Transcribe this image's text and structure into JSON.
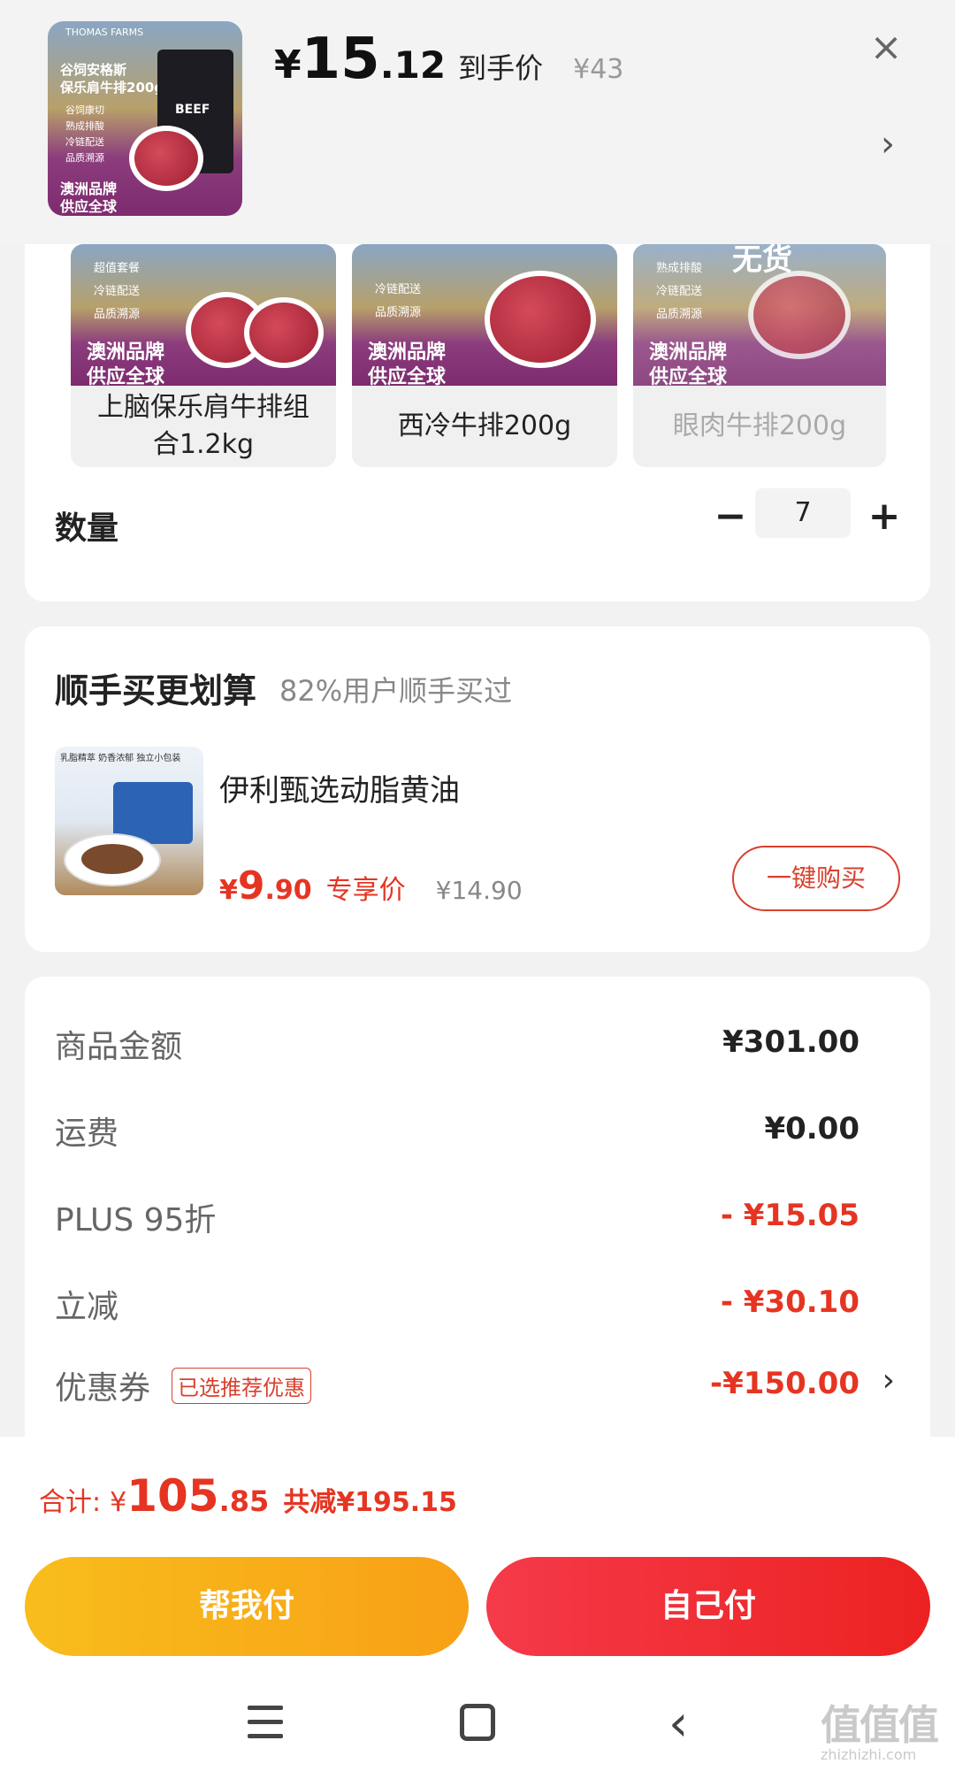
{
  "header": {
    "currency": "¥",
    "price_int": "15",
    "price_dec": ".12",
    "price_tag": "到手价",
    "original_price": "¥43",
    "close_label": "×",
    "arrow": "›",
    "thumb": {
      "brand": "THOMAS FARMS",
      "title_line1": "谷饲安格斯",
      "title_line2": "保乐肩牛排200g",
      "tags": [
        "谷饲康切",
        "熟成排酸",
        "冷链配送",
        "品质溯源"
      ],
      "slogan_line1": "澳洲品牌",
      "slogan_line2": "供应全球",
      "bag_text": "BEEF"
    }
  },
  "specs": {
    "items": [
      {
        "label": "上脑保乐肩牛排组合1.2kg",
        "tags": [
          "超值套餐",
          "冷链配送",
          "品质溯源"
        ],
        "slogan_line1": "澳洲品牌",
        "slogan_line2": "供应全球",
        "disabled": false
      },
      {
        "label": "西冷牛排200g",
        "tags": [
          "冷链配送",
          "品质溯源"
        ],
        "slogan_line1": "澳洲品牌",
        "slogan_line2": "供应全球",
        "disabled": false
      },
      {
        "label": "眼肉牛排200g",
        "tags": [
          "熟成排酸",
          "冷链配送",
          "品质溯源"
        ],
        "slogan_line1": "澳洲品牌",
        "slogan_line2": "供应全球",
        "disabled": true
      }
    ],
    "soldout_label": "无货",
    "quantity_label": "数量",
    "quantity_value": "7",
    "minus": "−",
    "plus": "+"
  },
  "addon": {
    "title": "顺手买更划算",
    "subtitle": "82%用户顺手买过",
    "product_name": "伊利甄选动脂黄油",
    "thumb_tags": "乳脂精萃  奶香浓郁  独立小包装",
    "currency": "¥",
    "price_int": "9",
    "price_dec": ".90",
    "price_tag": "专享价",
    "original_price": "¥14.90",
    "buy_label": "一键购买"
  },
  "summary": {
    "rows": [
      {
        "label": "商品金额",
        "value": "¥301.00"
      },
      {
        "label": "运费",
        "value": "¥0.00"
      },
      {
        "label": "PLUS 95折",
        "value": "- ¥15.05"
      },
      {
        "label": "立减",
        "value": "- ¥30.10"
      }
    ],
    "coupon": {
      "label": "优惠券",
      "badge": "已选推荐优惠",
      "value": "-¥150.00",
      "arrow": "›"
    }
  },
  "total": {
    "label": "合计:",
    "currency": "¥",
    "int": "105",
    "dec": ".85",
    "savings": "共减¥195.15"
  },
  "actions": {
    "help_pay": "帮我付",
    "self_pay": "自己付"
  },
  "watermark": {
    "text": "值值值",
    "domain": "zhizhizhi.com"
  },
  "colors": {
    "accent_red": "#e53522",
    "pay_yellow": "#f8b01c",
    "pay_red": "#ef2c36",
    "brand_purple": "#7d2b6f"
  }
}
